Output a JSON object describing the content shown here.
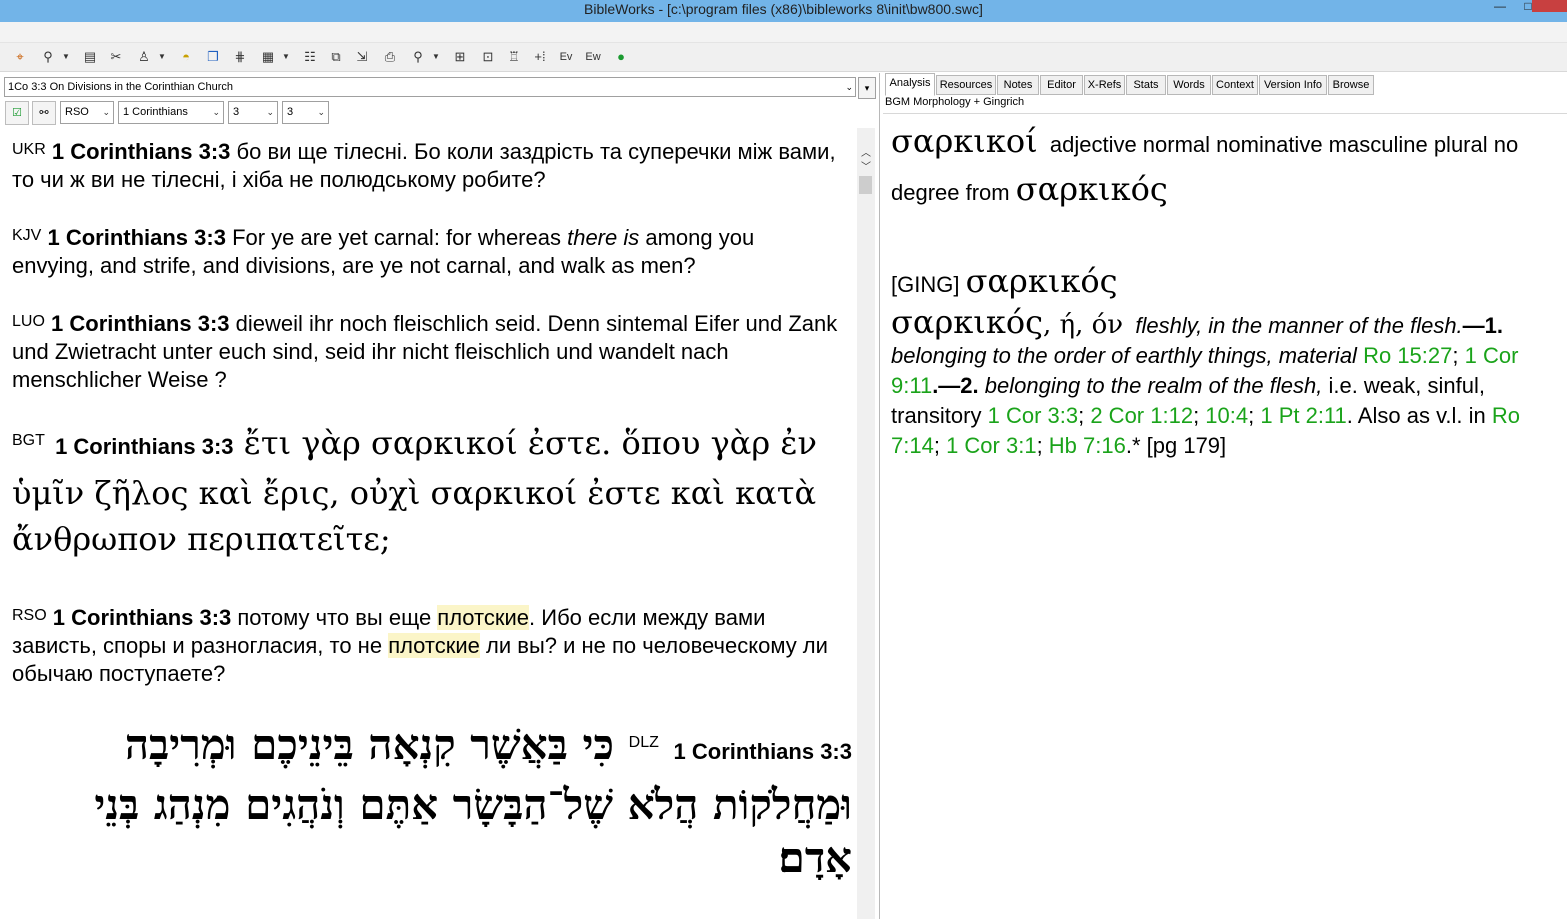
{
  "window": {
    "title": "BibleWorks - [c:\\program files (x86)\\bibleworks 8\\init\\bw800.swc]",
    "min_glyph": "—",
    "max_glyph": "□",
    "close_glyph": ""
  },
  "toolbar": {
    "icons": [
      "crosshair-icon",
      "word-search-icon",
      "document-stack-icon",
      "tools-icon",
      "person-icon",
      "bulb-icon",
      "windows-icon",
      "tree-icon",
      "grid-icon",
      "list-icon",
      "copy-icon",
      "export-icon",
      "print-icon",
      "user-search-icon",
      "layout-icon",
      "book-icon",
      "stamp-icon",
      "plus-icon",
      "ev-icon",
      "ew-icon",
      "globe-icon"
    ]
  },
  "left": {
    "verse_title": "1Co 3:3 On Divisions in the Corinthian Church",
    "version_combo": "RSO",
    "book_combo": "1 Corinthians",
    "chapter_combo": "3",
    "verse_combo": "3",
    "verses": [
      {
        "ver": "UKR",
        "ref": "1 Corinthians 3:3",
        "text": " бо ви ще тілесні. Бо коли заздрість та суперечки між вами, то чи ж ви не тілесні, і хіба не полюдському робите?"
      },
      {
        "ver": "KJV",
        "ref": "1 Corinthians 3:3",
        "pre": " For ye are yet carnal: for whereas ",
        "ital": "there is",
        "post": " among you envying, and strife, and divisions, are ye not carnal, and walk as men?"
      },
      {
        "ver": "LUO",
        "ref": "1 Corinthians 3:3",
        "text": " dieweil ihr noch fleischlich seid. Denn sintemal Eifer und Zank und Zwietracht unter euch sind, seid ihr nicht fleischlich und wandelt nach menschlicher Weise ?"
      },
      {
        "ver": "BGT",
        "ref": "1 Corinthians 3:3",
        "text": " ἔτι γὰρ σαρκικοί ἐστε. ὅπου γὰρ ἐν ὑμῖν ζῆλος καὶ ἔρις, οὐχὶ σαρκικοί ἐστε καὶ κατὰ ἄνθρωπον περιπατεῖτε;"
      },
      {
        "ver": "RSO",
        "ref": "1 Corinthians 3:3",
        "p1": " потому что вы еще ",
        "h1": "плотские",
        "p2": ". Ибо если между вами зависть, споры и разногласия, то не ",
        "h2": "плотские",
        "p3": " ли вы? и не по человеческому ли обычаю поступаете?"
      },
      {
        "ver": "DLZ",
        "ref": "1 Corinthians 3:3",
        "text": "כִּי בַּאֲשֶׁר קִנְאָה בֵּינֵיכֶם וּמְרִיבָה וּמַחֲלֹקוֹת הֲלֹא שֶׁל־הַבָּשָׂר אַתֶּם וְנֹהֲגִים מִנְהַג בְּנֵי אָדָם׃"
      }
    ]
  },
  "right": {
    "tabs": [
      "Analysis",
      "Resources",
      "Notes",
      "Editor",
      "X-Refs",
      "Stats",
      "Words",
      "Context",
      "Version Info",
      "Browse"
    ],
    "module_label": "BGM Morphology + Gingrich",
    "word": "σαρκικοί",
    "parse": "adjective normal nominative masculine plural no degree from",
    "lemma": "σαρκικός",
    "ging_tag": "[GING]",
    "ging_lemma": "σαρκικός",
    "entry_head": "σαρκικός",
    "entry_forms": ", ή, όν",
    "def_1_intro": "fleshly, in the manner of the flesh.",
    "def_1_num": "—1.",
    "def_1": "belonging to the order of earthly things, material",
    "ref_ro1527": "Ro 15:27",
    "ref_1cor911": "1 Cor 9:11",
    "def_2_num": ".—2.",
    "def_2": "belonging to the realm of the flesh,",
    "def_2_ie": " i.e. weak, sinful, transitory ",
    "ref_1cor33": "1 Cor 3:3",
    "ref_2cor112": "2 Cor 1:12",
    "ref_104": "10:4",
    "ref_1pt211": "1 Pt 2:11",
    "also": ". Also as v.l. in ",
    "ref_ro714": "Ro 7:14",
    "ref_1cor31": "1 Cor 3:1",
    "ref_hb716": "Hb 7:16",
    "tail": ".* [pg 179]"
  }
}
